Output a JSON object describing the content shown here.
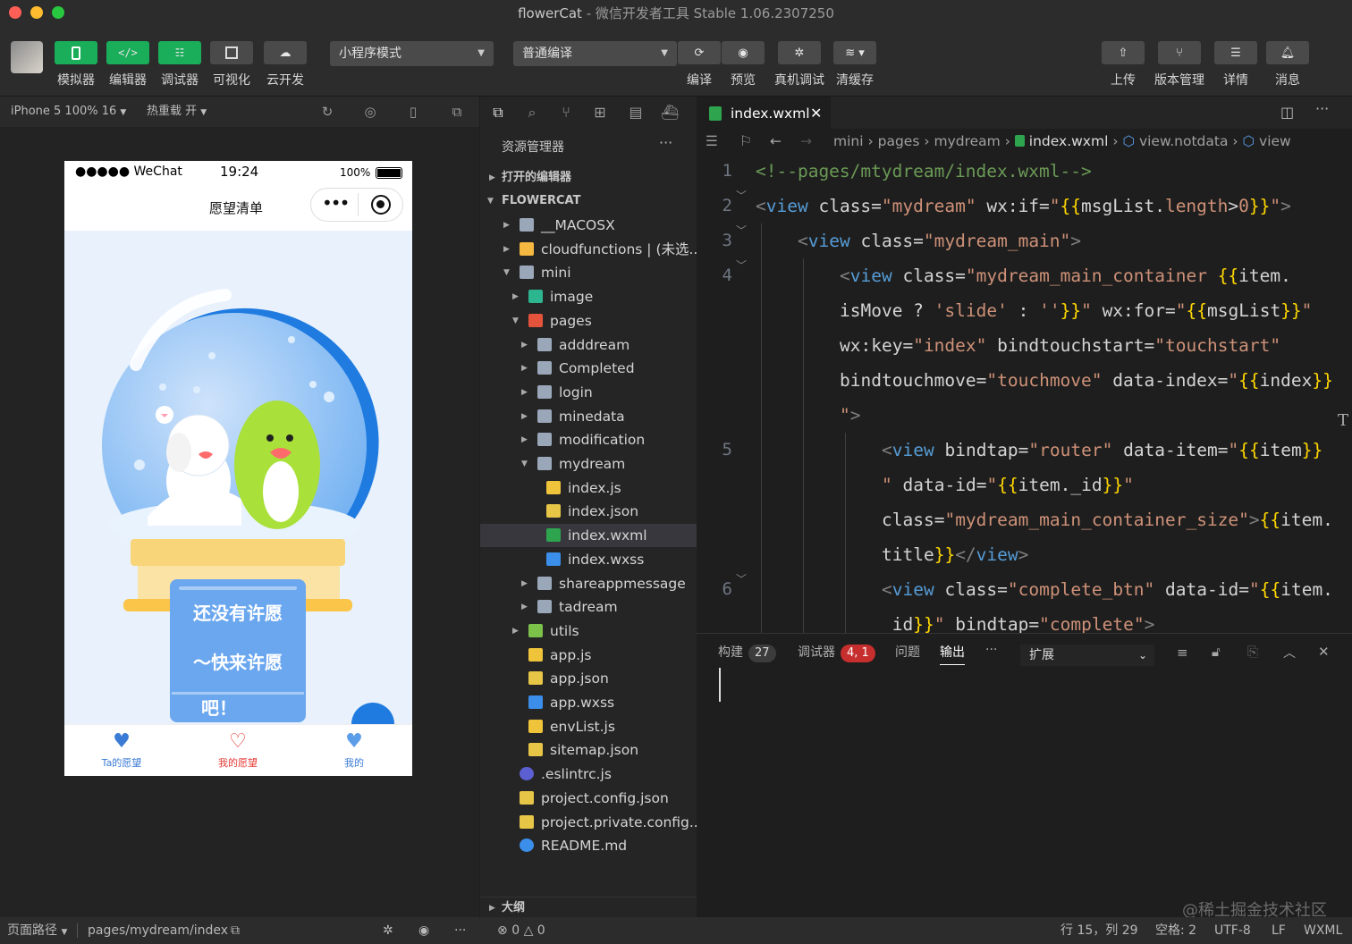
{
  "window": {
    "project": "flowerCat",
    "sep": " - ",
    "app_title": "微信开发者工具 Stable 1.06.2307250"
  },
  "toolbar": {
    "simulator_label": "模拟器",
    "editor_label": "编辑器",
    "debugger_label": "调试器",
    "visual_label": "可视化",
    "cloud_label": "云开发",
    "mode_select": "小程序模式",
    "compile_select": "普通编译",
    "compile_label": "编译",
    "preview_label": "预览",
    "realdebug_label": "真机调试",
    "clearcache_label": "清缓存",
    "upload_label": "上传",
    "version_label": "版本管理",
    "details_label": "详情",
    "messages_label": "消息",
    "accent_color": "#1aad5a"
  },
  "simulator": {
    "device": "iPhone 5 100% 16",
    "hotreload": "热重载 开",
    "status": {
      "carrier": "●●●●● WeChat",
      "time": "19:24",
      "battery": "100%"
    },
    "nav_title": "愿望清单",
    "card_line1": "还没有许愿",
    "card_line2": "～快来许愿",
    "card_line3": "吧！",
    "tabs": [
      "Ta的愿望",
      "我的愿望",
      "我的"
    ]
  },
  "explorer": {
    "title": "资源管理器",
    "open_editors": "打开的编辑器",
    "root": "FLOWERCAT",
    "outline": "大纲",
    "items": [
      {
        "name": "__MACOSX",
        "indent": 0,
        "type": "folder",
        "arrow": "right"
      },
      {
        "name": "cloudfunctions | (未选...",
        "indent": 0,
        "type": "cloudfolder",
        "arrow": "right"
      },
      {
        "name": "mini",
        "indent": 0,
        "type": "folderopen",
        "arrow": "down"
      },
      {
        "name": "image",
        "indent": 1,
        "type": "imgfolder",
        "arrow": "right"
      },
      {
        "name": "pages",
        "indent": 1,
        "type": "pagesfolder",
        "arrow": "down"
      },
      {
        "name": "adddream",
        "indent": 2,
        "type": "folder",
        "arrow": "right"
      },
      {
        "name": "Completed",
        "indent": 2,
        "type": "folder",
        "arrow": "right"
      },
      {
        "name": "login",
        "indent": 2,
        "type": "folder",
        "arrow": "right"
      },
      {
        "name": "minedata",
        "indent": 2,
        "type": "folder",
        "arrow": "right"
      },
      {
        "name": "modification",
        "indent": 2,
        "type": "folder",
        "arrow": "right"
      },
      {
        "name": "mydream",
        "indent": 2,
        "type": "folderopen",
        "arrow": "down"
      },
      {
        "name": "index.js",
        "indent": 3,
        "type": "js",
        "arrow": ""
      },
      {
        "name": "index.json",
        "indent": 3,
        "type": "json",
        "arrow": ""
      },
      {
        "name": "index.wxml",
        "indent": 3,
        "type": "wxml",
        "arrow": "",
        "active": true
      },
      {
        "name": "index.wxss",
        "indent": 3,
        "type": "wxss",
        "arrow": ""
      },
      {
        "name": "shareappmessage",
        "indent": 2,
        "type": "folder",
        "arrow": "right"
      },
      {
        "name": "tadream",
        "indent": 2,
        "type": "folder",
        "arrow": "right"
      },
      {
        "name": "utils",
        "indent": 1,
        "type": "utilsfolder",
        "arrow": "right"
      },
      {
        "name": "app.js",
        "indent": 1,
        "type": "js",
        "arrow": ""
      },
      {
        "name": "app.json",
        "indent": 1,
        "type": "json",
        "arrow": ""
      },
      {
        "name": "app.wxss",
        "indent": 1,
        "type": "wxss",
        "arrow": ""
      },
      {
        "name": "envList.js",
        "indent": 1,
        "type": "js",
        "arrow": ""
      },
      {
        "name": "sitemap.json",
        "indent": 1,
        "type": "json",
        "arrow": ""
      },
      {
        "name": ".eslintrc.js",
        "indent": 0,
        "type": "eslint",
        "arrow": ""
      },
      {
        "name": "project.config.json",
        "indent": 0,
        "type": "json",
        "arrow": ""
      },
      {
        "name": "project.private.config...",
        "indent": 0,
        "type": "json",
        "arrow": ""
      },
      {
        "name": "README.md",
        "indent": 0,
        "type": "info",
        "arrow": ""
      }
    ]
  },
  "editor": {
    "tab": "index.wxml",
    "breadcrumb": [
      "mini",
      "pages",
      "mydream",
      "index.wxml",
      "view.notdata",
      "view"
    ],
    "line_numbers": [
      "1",
      "2",
      "3",
      "4",
      "5",
      "6"
    ]
  },
  "panel": {
    "build": "构建",
    "build_count": "27",
    "debugger": "调试器",
    "debugger_count": "4, 1",
    "problems": "问题",
    "output": "输出",
    "more": "···",
    "select": "扩展",
    "error_color": "#c72e2e"
  },
  "statusbar": {
    "page_path_label": "页面路径",
    "page_path": "pages/mydream/index",
    "errors": "0",
    "warnings": "0",
    "cursor": "行 15，列 29",
    "spaces": "空格: 2",
    "encoding": "UTF-8",
    "eol": "LF",
    "language": "WXML",
    "watermark": "@稀土掘金技术社区"
  }
}
